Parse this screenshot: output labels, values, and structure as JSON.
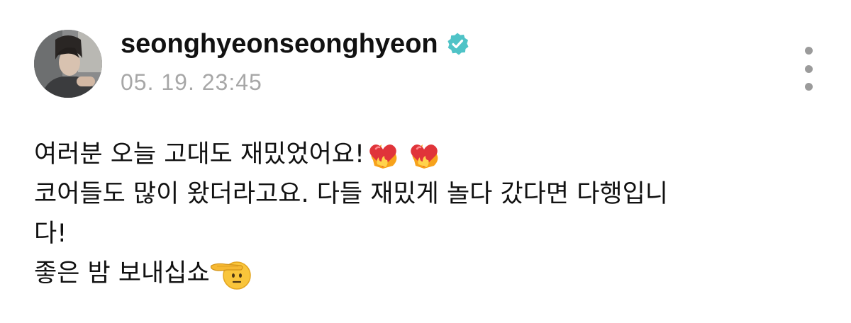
{
  "post": {
    "username": "seonghyeonseonghyeon",
    "verified": true,
    "timestamp": "05. 19. 23:45",
    "lines": [
      "여러분 오늘 고대도 재밌었어요!",
      "코어들도 많이 왔더라고요. 다들 재밌게 놀다 갔다면 다행입니",
      "다!",
      "좋은 밤 보내십쇼"
    ],
    "emojis": {
      "line1": [
        "heart-on-fire",
        "heart-on-fire"
      ],
      "line4": [
        "saluting-face"
      ]
    }
  },
  "colors": {
    "verified_badge": "#4fc3c7",
    "timestamp": "#a7a7a7",
    "more_dots": "#9b9b9b"
  },
  "icons": {
    "more": "more-vertical-icon",
    "verified": "verified-badge-icon"
  }
}
